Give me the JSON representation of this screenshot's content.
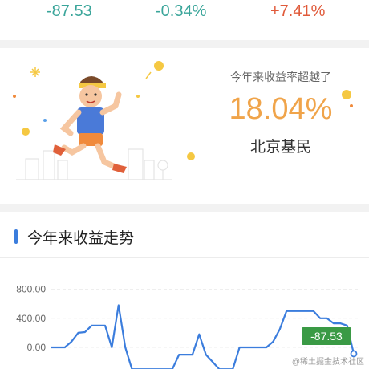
{
  "stats": [
    {
      "label": "stat-1",
      "value": "-87.53",
      "color": "#3aa59a"
    },
    {
      "label": "stat-2",
      "value": "-0.34%",
      "color": "#3aa59a"
    },
    {
      "label": "stat-3",
      "value": "+7.41%",
      "color": "#e05a3a"
    }
  ],
  "rank": {
    "caption": "今年来收益率超越了",
    "value": "18.04%",
    "city": "北京基民",
    "illustration": "running-man-illustration"
  },
  "trend": {
    "title": "今年来收益走势",
    "end_value_badge": "-87.53",
    "accent_color": "#3b7ddd",
    "badge_color": "#3a9a45"
  },
  "chart_data": {
    "type": "line",
    "ylabels": [
      "800.00",
      "400.00",
      "0.00"
    ],
    "ylim_visible": [
      -250,
      1000
    ],
    "series": [
      {
        "values": [
          0,
          0,
          0,
          80,
          200,
          210,
          300,
          300,
          300,
          0,
          580,
          0,
          -300,
          -300,
          -300,
          -300,
          -300,
          -300,
          -300,
          -100,
          -100,
          -100,
          180,
          -100,
          -200,
          -300,
          -300,
          -300,
          0,
          0,
          0,
          0,
          0,
          80,
          250,
          500,
          500,
          500,
          500,
          500,
          400,
          400,
          330,
          330,
          300,
          -87.53
        ]
      }
    ]
  },
  "watermark": "@稀土掘金技术社区"
}
